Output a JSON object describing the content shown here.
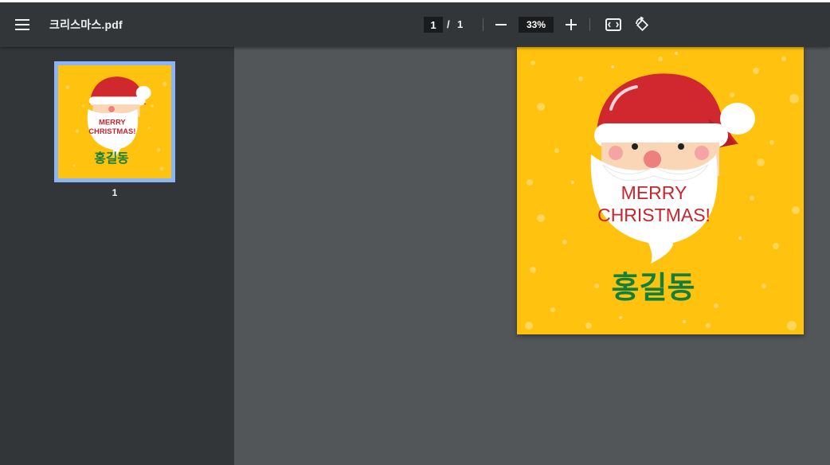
{
  "toolbar": {
    "title": "크리스마스.pdf",
    "current_page": "1",
    "separator": "/",
    "total_pages": "1",
    "zoom": "33%"
  },
  "icons": {
    "menu": "hamburger-menu-icon",
    "zoom_out": "minus-icon",
    "zoom_in": "plus-icon",
    "fit": "fit-to-page-icon",
    "rotate": "rotate-counterclockwise-icon"
  },
  "thumbnails": [
    {
      "label": "1"
    }
  ],
  "document": {
    "card_line1": "MERRY",
    "card_line2": "CHRISTMAS!",
    "name": "홍길동"
  },
  "colors": {
    "toolbar": "#323639",
    "viewer_bg": "#525659",
    "thumb_border": "#8ab4f8",
    "card_yellow": "#ffc20e",
    "santa_red": "#d0282e",
    "name_green": "#137f3c"
  }
}
